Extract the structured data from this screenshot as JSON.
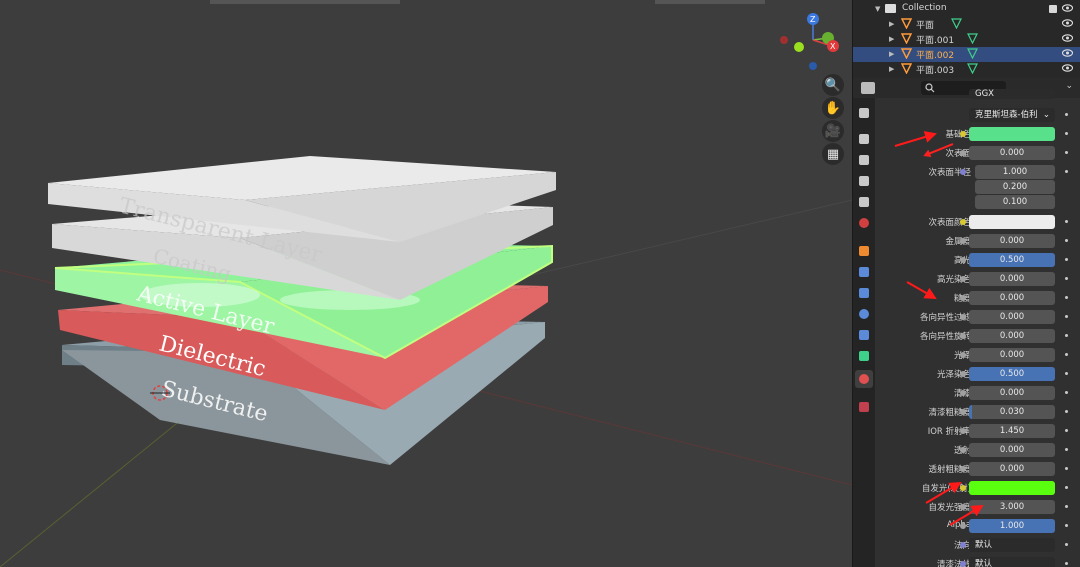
{
  "viewport": {
    "layer_labels": {
      "top": "Transparent Layer",
      "second": "Coating",
      "active": "Active Layer",
      "dielectric": "Dielectric",
      "substrate": "Substrate"
    },
    "gizmo": {
      "z": "Z",
      "y": "Y",
      "x": "X"
    },
    "tools": {
      "zoom": "🔍",
      "pan": "✋",
      "camera": "🎥",
      "grid": "▦"
    }
  },
  "outliner": {
    "collection": "Collection",
    "items": [
      {
        "name": "平面",
        "selected": false
      },
      {
        "name": "平面.001",
        "selected": false
      },
      {
        "name": "平面.002",
        "selected": true
      },
      {
        "name": "平面.003",
        "selected": false
      }
    ]
  },
  "properties": {
    "distribution": "GGX",
    "subsurface_method": "克里斯坦森-伯利",
    "rows": [
      {
        "label": "基础色",
        "type": "color",
        "color": "#58e08a",
        "dot": "yel"
      },
      {
        "label": "次表面",
        "type": "num",
        "value": "0.000"
      },
      {
        "label": "次表面半径",
        "type": "vec",
        "values": [
          "1.000",
          "0.200",
          "0.100"
        ],
        "dot": "pur"
      },
      {
        "label": "次表面颜色",
        "type": "color",
        "color": "#ececec",
        "dot": "yel"
      },
      {
        "label": "金属度",
        "type": "num",
        "value": "0.000"
      },
      {
        "label": "高光",
        "type": "num",
        "value": "0.500",
        "fill": 1.0
      },
      {
        "label": "高光染色",
        "type": "num",
        "value": "0.000"
      },
      {
        "label": "糙度",
        "type": "num",
        "value": "0.000"
      },
      {
        "label": "各向异性过滤",
        "type": "num",
        "value": "0.000"
      },
      {
        "label": "各向异性旋转",
        "type": "num",
        "value": "0.000"
      },
      {
        "label": "光泽",
        "type": "num",
        "value": "0.000"
      },
      {
        "label": "光泽染色",
        "type": "num",
        "value": "0.500",
        "fill": 1.0
      },
      {
        "label": "清漆",
        "type": "num",
        "value": "0.000"
      },
      {
        "label": "清漆粗糙度",
        "type": "num",
        "value": "0.030",
        "fill": 0.03
      },
      {
        "label": "IOR 折射率",
        "type": "num",
        "value": "1.450"
      },
      {
        "label": "透射",
        "type": "num",
        "value": "0.000"
      },
      {
        "label": "透射粗糙度",
        "type": "num",
        "value": "0.000"
      },
      {
        "label": "自发光(发射)",
        "type": "color",
        "color": "#5aff10",
        "dot": "yel"
      },
      {
        "label": "自发光强度",
        "type": "num",
        "value": "3.000"
      },
      {
        "label": "Alpha",
        "type": "num",
        "value": "1.000",
        "fill": 1.0
      },
      {
        "label": "法向",
        "type": "text",
        "value": "默认",
        "dot": "pur"
      },
      {
        "label": "清漆法线",
        "type": "text",
        "value": "默认",
        "dot": "pur"
      }
    ]
  }
}
